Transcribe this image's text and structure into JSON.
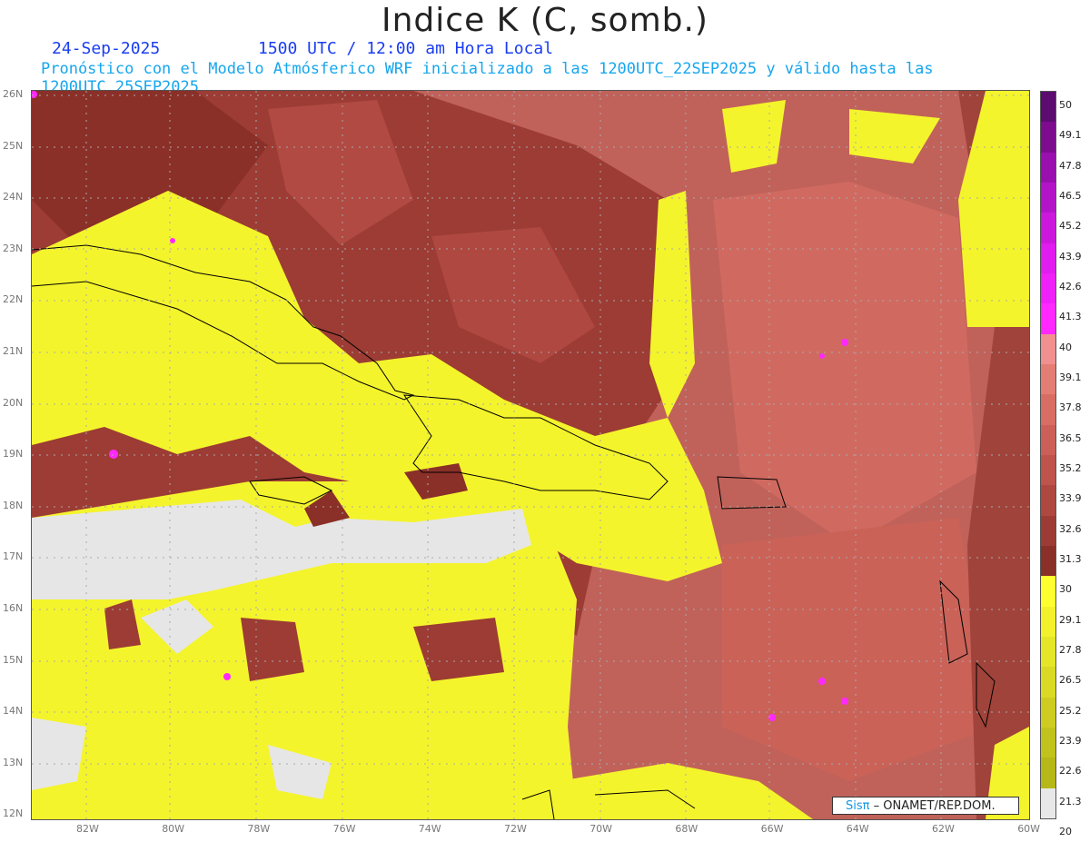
{
  "title": "Indice K (C, somb.)",
  "date_label": "24-Sep-2025",
  "time_label": "1500 UTC / 12:00 am Hora Local",
  "description": "Pronóstico con el Modelo Atmósferico WRF inicializado a las 1200UTC_22SEP2025 y válido hasta las  1200UTC_25SEP2025",
  "lat_labels": [
    "26N",
    "25N",
    "24N",
    "23N",
    "22N",
    "21N",
    "20N",
    "19N",
    "18N",
    "17N",
    "16N",
    "15N",
    "14N",
    "13N",
    "12N"
  ],
  "lon_labels": [
    "82W",
    "80W",
    "78W",
    "76W",
    "74W",
    "72W",
    "70W",
    "68W",
    "66W",
    "64W",
    "62W",
    "60W"
  ],
  "colorbar": {
    "levels": [
      "50",
      "49.1",
      "47.8",
      "46.5",
      "45.2",
      "43.9",
      "42.6",
      "41.3",
      "40",
      "39.1",
      "37.8",
      "36.5",
      "35.2",
      "33.9",
      "32.6",
      "31.3",
      "30",
      "29.1",
      "27.8",
      "26.5",
      "25.2",
      "23.9",
      "22.6",
      "21.3",
      "20"
    ],
    "colors": [
      "#5c0c6e",
      "#7d0c8e",
      "#9a10ae",
      "#b414c8",
      "#cc18dc",
      "#e01cee",
      "#f020f8",
      "#ff28ff",
      "#f09090",
      "#e47d74",
      "#d86d64",
      "#cc6058",
      "#be544c",
      "#ae4840",
      "#9c3c34",
      "#8a3028",
      "#ffff30",
      "#f2f22c",
      "#e6e628",
      "#dada24",
      "#cecc20",
      "#c2c21c",
      "#b6b818",
      "#e8e8e8"
    ]
  },
  "logo": {
    "brand": "Sisπ",
    "text": "– ONAMET/REP.DOM."
  }
}
